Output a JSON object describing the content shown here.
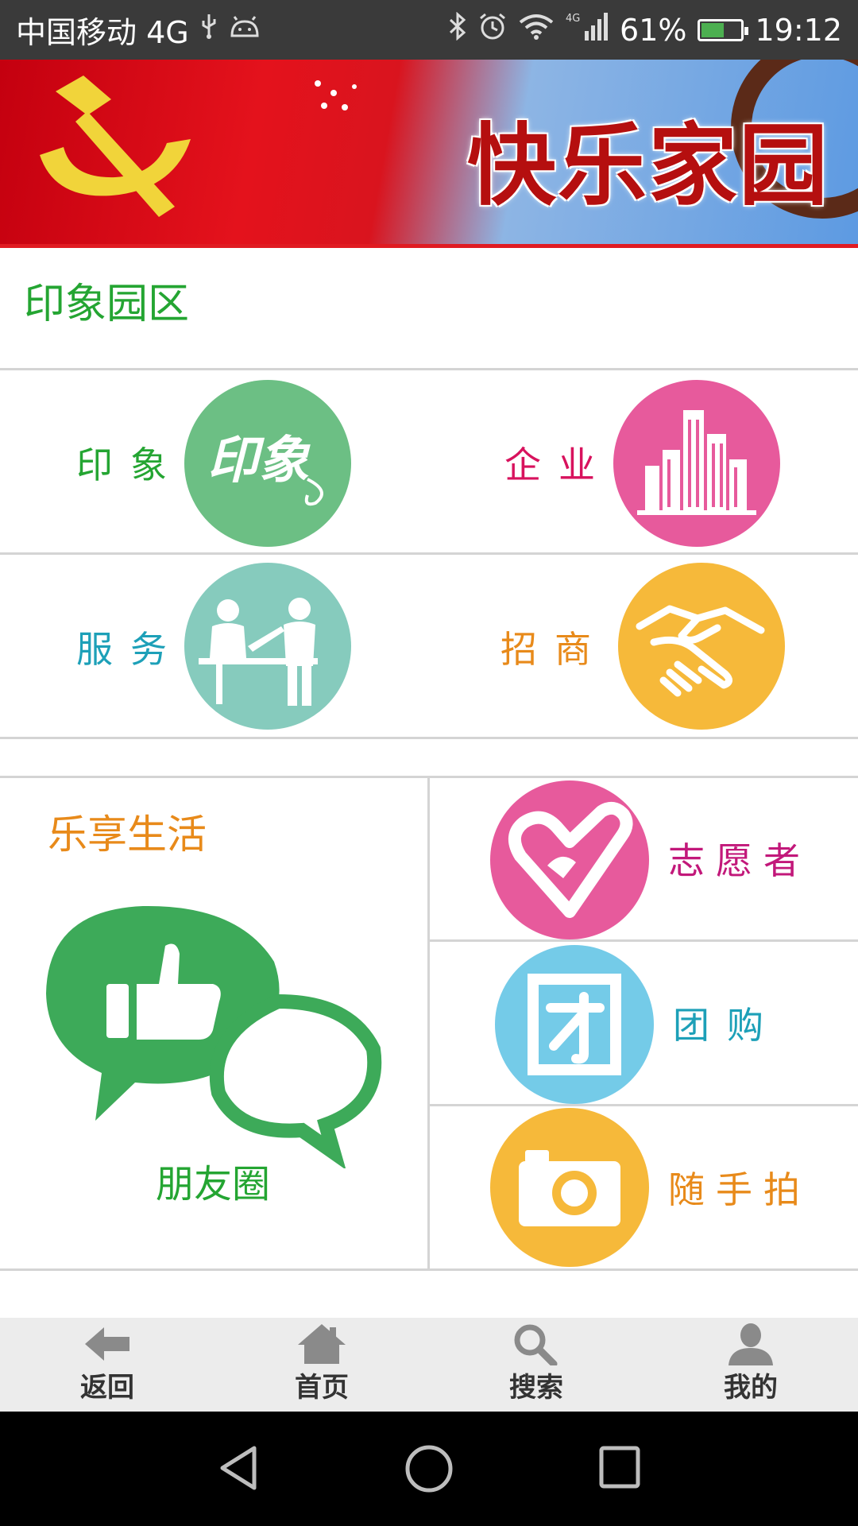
{
  "status_bar": {
    "carrier": "中国移动 4G",
    "battery_percent": "61%",
    "battery_level": 0.61,
    "time": "19:12",
    "icons": [
      "usb-icon",
      "android-icon",
      "bluetooth-icon",
      "alarm-icon",
      "wifi-icon",
      "signal-icon",
      "battery-icon"
    ]
  },
  "banner": {
    "title": "快乐家园"
  },
  "impression_park": {
    "title": "印象园区",
    "tiles": [
      {
        "label": "印象",
        "color": "#24a532",
        "circle_color": "#6cbf84",
        "icon": "yinxiang-logo-icon"
      },
      {
        "label": "企业",
        "color": "#d8125d",
        "circle_color": "#e75a9c",
        "icon": "buildings-icon"
      },
      {
        "label": "服务",
        "color": "#1da0b8",
        "circle_color": "#86cbbd",
        "icon": "service-desk-icon"
      },
      {
        "label": "招商",
        "color": "#e88a1a",
        "circle_color": "#f6b93a",
        "icon": "handshake-icon"
      }
    ]
  },
  "enjoy_life": {
    "title": "乐享生活",
    "moments_label": "朋友圈",
    "items": [
      {
        "label": "志愿者",
        "color": "#c2187a",
        "circle_color": "#e75a9c",
        "icon": "heart-hand-icon"
      },
      {
        "label": "团购",
        "color": "#1da0b8",
        "circle_color": "#74cbe8",
        "icon": "group-buy-icon"
      },
      {
        "label": "随手拍",
        "color": "#e88a1a",
        "circle_color": "#f6b93a",
        "icon": "camera-icon"
      }
    ]
  },
  "tab_bar": {
    "tabs": [
      {
        "label": "返回",
        "icon": "back-arrow-icon"
      },
      {
        "label": "首页",
        "icon": "home-icon"
      },
      {
        "label": "搜索",
        "icon": "search-icon"
      },
      {
        "label": "我的",
        "icon": "user-icon"
      }
    ]
  },
  "nav_bar": {
    "buttons": [
      "back-triangle-icon",
      "home-circle-icon",
      "recents-square-icon"
    ]
  }
}
